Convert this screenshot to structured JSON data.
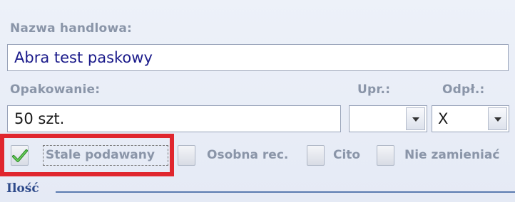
{
  "trade_name": {
    "label": "Nazwa handlowa:",
    "value": "Abra test paskowy"
  },
  "packaging": {
    "label": "Opakowanie:",
    "value": "50 szt."
  },
  "upr": {
    "label": "Upr.:",
    "value": ""
  },
  "odpl": {
    "label": "Odpł.:",
    "value": "X"
  },
  "checkboxes": [
    {
      "label": "Stale podawany",
      "checked": true
    },
    {
      "label": "Osobna rec.",
      "checked": false
    },
    {
      "label": "Cito",
      "checked": false
    },
    {
      "label": "Nie zamieniać",
      "checked": false
    }
  ],
  "quantity_group": {
    "label": "Ilość"
  },
  "colors": {
    "highlight": "#e0262e",
    "label": "#8a95a8",
    "field_text": "#1a1a8a"
  },
  "icons": {
    "check": "check-icon",
    "dropdown": "chevron-down-icon"
  }
}
